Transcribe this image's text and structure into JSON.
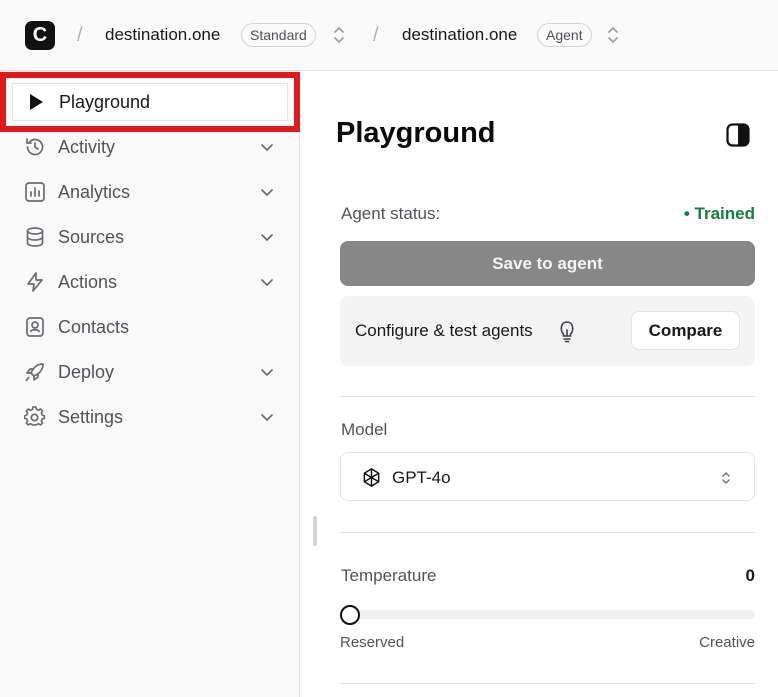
{
  "header": {
    "logo_letter": "C",
    "separator": "/",
    "workspace": {
      "name": "destination.one",
      "badge": "Standard"
    },
    "agent": {
      "name": "destination.one",
      "badge": "Agent"
    }
  },
  "sidebar": {
    "items": [
      {
        "label": "Playground",
        "icon": "play-icon",
        "expandable": false,
        "active": true
      },
      {
        "label": "Activity",
        "icon": "history-icon",
        "expandable": true
      },
      {
        "label": "Analytics",
        "icon": "bar-chart-icon",
        "expandable": true
      },
      {
        "label": "Sources",
        "icon": "database-icon",
        "expandable": true
      },
      {
        "label": "Actions",
        "icon": "lightning-icon",
        "expandable": true
      },
      {
        "label": "Contacts",
        "icon": "contact-icon",
        "expandable": false
      },
      {
        "label": "Deploy",
        "icon": "rocket-icon",
        "expandable": true
      },
      {
        "label": "Settings",
        "icon": "gear-icon",
        "expandable": true
      }
    ]
  },
  "main": {
    "title": "Playground",
    "agent_status": {
      "label": "Agent status:",
      "value": "Trained",
      "color": "#15803d"
    },
    "save_button": "Save to agent",
    "configure": {
      "text": "Configure & test agents",
      "compare_button": "Compare"
    },
    "model": {
      "label": "Model",
      "value": "GPT-4o"
    },
    "temperature": {
      "label": "Temperature",
      "value": "0",
      "slider_fraction": 0,
      "min_label": "Reserved",
      "max_label": "Creative"
    }
  },
  "colors": {
    "highlight": "#e21a1a",
    "save_button_bg": "#878787",
    "status_green": "#15803d"
  }
}
